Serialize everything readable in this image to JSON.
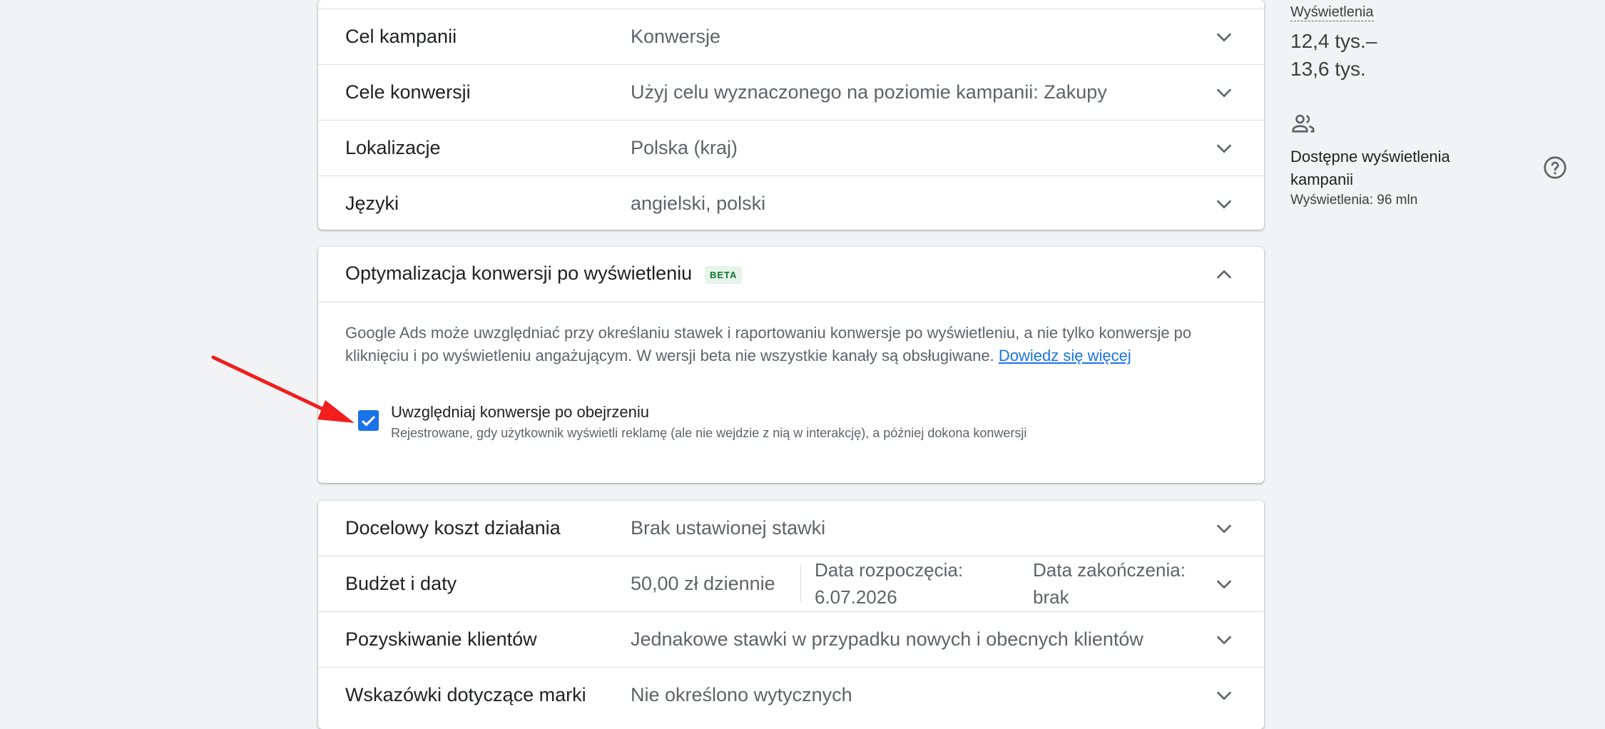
{
  "settings_top": [
    {
      "label": "Cel kampanii",
      "value": "Konwersje"
    },
    {
      "label": "Cele konwersji",
      "value": "Użyj celu wyznaczonego na poziomie kampanii: Zakupy"
    },
    {
      "label": "Lokalizacje",
      "value": "Polska (kraj)"
    },
    {
      "label": "Języki",
      "value": "angielski, polski"
    }
  ],
  "optimization": {
    "title": "Optymalizacja konwersji po wyświetleniu",
    "badge": "BETA",
    "description_line1": "Google Ads może uwzględniać przy określaniu stawek i raportowaniu konwersje po wyświetleniu, a nie tylko konwersje po",
    "description_line2": "kliknięciu i po wyświetleniu angażującym. W wersji beta nie wszystkie kanały są obsługiwane. ",
    "learn_more": "Dowiedz się więcej",
    "checkbox_label": "Uwzględniaj konwersje po obejrzeniu",
    "checkbox_checked": true,
    "checkbox_sub": "Rejestrowane, gdy użytkownik wyświetli reklamę (ale nie wejdzie z nią w interakcję), a później dokona konwersji"
  },
  "settings_bottom": {
    "target_cost": {
      "label": "Docelowy koszt działania",
      "value": "Brak ustawionej stawki"
    },
    "budget": {
      "label": "Budżet i daty",
      "value": "50,00 zł dziennie",
      "start_label": "Data rozpoczęcia:",
      "start_value": "6.07.2026",
      "end_label": "Data zakończenia:",
      "end_value": "brak"
    },
    "acquisition": {
      "label": "Pozyskiwanie klientów",
      "value": "Jednakowe stawki w przypadku nowych i obecnych klientów"
    },
    "brand": {
      "label": "Wskazówki dotyczące marki",
      "value": "Nie określono wytycznych"
    }
  },
  "sidebar": {
    "metric_label": "Wyświetlenia",
    "metric_value_line1": "12,4 tys.–",
    "metric_value_line2": "13,6 tys.",
    "available_title": "Dostępne wyświetlenia kampanii",
    "available_sub": "Wyświetlenia: 96 mln"
  },
  "colors": {
    "accent": "#1a73e8",
    "annotation_arrow": "#f21d1d",
    "beta_bg": "#e6f4ea",
    "beta_text": "#137333"
  },
  "icons": [
    "chevron-down-icon",
    "chevron-up-icon",
    "check-icon",
    "people-icon",
    "help-icon"
  ]
}
